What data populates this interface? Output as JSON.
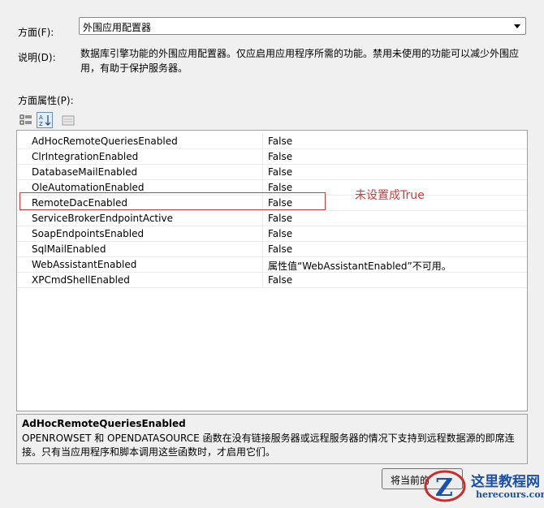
{
  "facet": {
    "label": "方面(F):",
    "selected": "外围应用配置器"
  },
  "description": {
    "label": "说明(D):",
    "text": "数据库引擎功能的外围应用配置器。仅应启用应用程序所需的功能。禁用未使用的功能可以减少外围应用，有助于保护服务器。"
  },
  "properties": {
    "label": "方面属性(P):",
    "rows": [
      {
        "name": "AdHocRemoteQueriesEnabled",
        "value": "False"
      },
      {
        "name": "ClrIntegrationEnabled",
        "value": "False"
      },
      {
        "name": "DatabaseMailEnabled",
        "value": "False"
      },
      {
        "name": "OleAutomationEnabled",
        "value": "False"
      },
      {
        "name": "RemoteDacEnabled",
        "value": "False"
      },
      {
        "name": "ServiceBrokerEndpointActive",
        "value": "False"
      },
      {
        "name": "SoapEndpointsEnabled",
        "value": "False"
      },
      {
        "name": "SqlMailEnabled",
        "value": "False"
      },
      {
        "name": "WebAssistantEnabled",
        "value": "属性值“WebAssistantEnabled”不可用。"
      },
      {
        "name": "XPCmdShellEnabled",
        "value": "False"
      }
    ]
  },
  "annotation": "未设置成True",
  "property_description": {
    "title": "AdHocRemoteQueriesEnabled",
    "body": "OPENROWSET 和 OPENDATASOURCE 函数在没有链接服务器或远程服务器的情况下支持到远程数据源的即席连接。只有当应用程序和脚本调用这些函数时，才启用它们。"
  },
  "buttons": {
    "reset_label": "将当前的"
  },
  "watermark": {
    "title": "这里教程网",
    "url": "herecours.com"
  },
  "colors": {
    "annotation": "#d03a3a",
    "watermark": "#1b4fa8"
  }
}
